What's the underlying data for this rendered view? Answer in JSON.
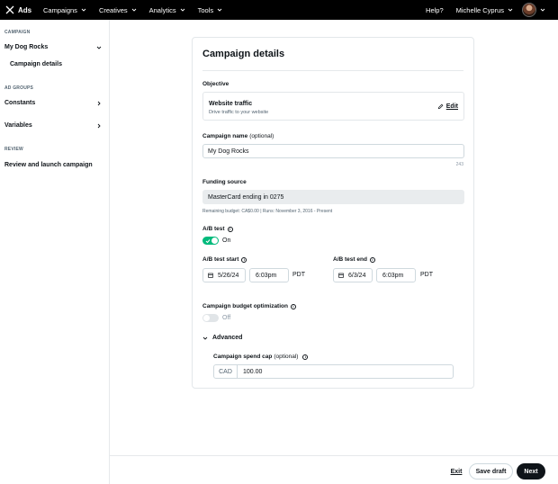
{
  "topbar": {
    "brand": "Ads",
    "nav": [
      {
        "label": "Campaigns"
      },
      {
        "label": "Creatives"
      },
      {
        "label": "Analytics"
      },
      {
        "label": "Tools"
      }
    ],
    "help": "Help?",
    "user_name": "Michelle Cyprus"
  },
  "sidebar": {
    "campaign_section": "CAMPAIGN",
    "campaign_item": "My Dog Rocks",
    "campaign_sub": "Campaign details",
    "ad_groups_section": "AD GROUPS",
    "constants": "Constants",
    "variables": "Variables",
    "review_section": "REVIEW",
    "review_item": "Review and launch campaign"
  },
  "card": {
    "title": "Campaign details",
    "objective_label": "Objective",
    "objective_title": "Website traffic",
    "objective_sub": "Drive traffic to your website",
    "edit_label": "Edit",
    "name_label": "Campaign name",
    "name_optional": "(optional)",
    "name_value": "My Dog Rocks",
    "name_counter": "243",
    "funding_label": "Funding source",
    "funding_value": "MasterCard ending in 0275",
    "funding_note": "Remaining budget: CA$0.00 | Runs: November 3, 2016 - Present",
    "ab_label": "A/B test",
    "ab_state": "On",
    "ab_start_label": "A/B test start",
    "ab_start_date": "5/26/24",
    "ab_start_time": "6:03pm",
    "ab_start_tz": "PDT",
    "ab_end_label": "A/B test end",
    "ab_end_date": "6/3/24",
    "ab_end_time": "6:03pm",
    "ab_end_tz": "PDT",
    "cbo_label": "Campaign budget optimization",
    "cbo_state": "Off",
    "advanced_label": "Advanced",
    "spend_cap_label": "Campaign spend cap",
    "spend_cap_optional": "(optional)",
    "spend_cap_currency": "CAD",
    "spend_cap_value": "100.00"
  },
  "footer": {
    "exit": "Exit",
    "save_draft": "Save draft",
    "next": "Next"
  },
  "colors": {
    "toggle_on": "#00ba7c",
    "primary_button": "#0f1419",
    "topbar": "#000000"
  }
}
